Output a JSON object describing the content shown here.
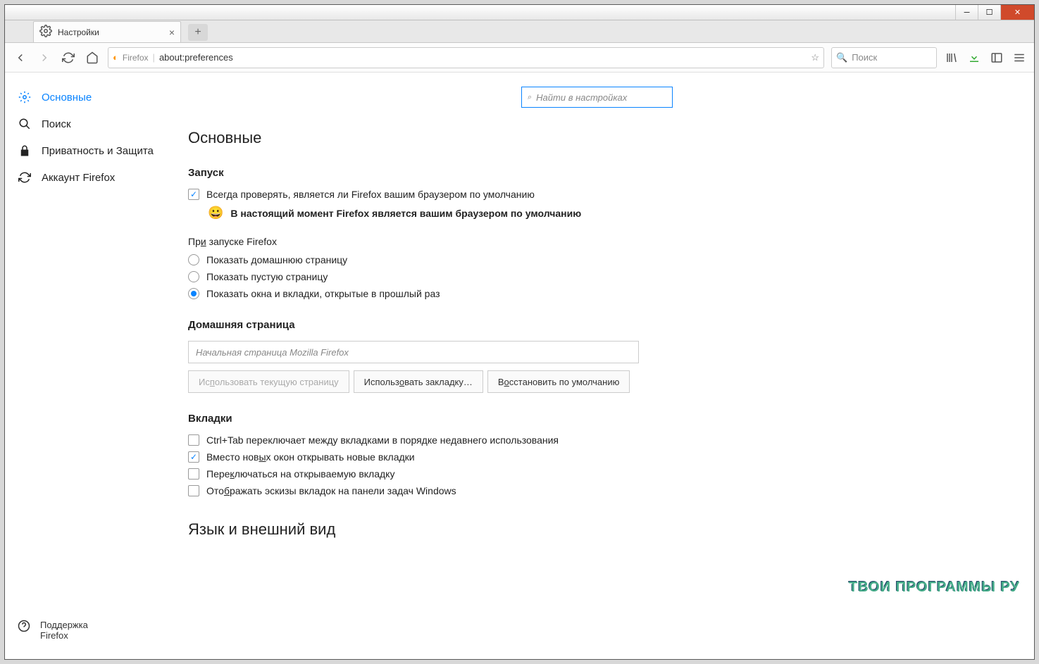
{
  "tab": {
    "title": "Настройки"
  },
  "urlbar": {
    "identity": "Firefox",
    "url": "about:preferences"
  },
  "searchbar": {
    "placeholder": "Поиск"
  },
  "sidebar": {
    "items": [
      {
        "label": "Основные"
      },
      {
        "label": "Поиск"
      },
      {
        "label": "Приватность и Защита"
      },
      {
        "label": "Аккаунт Firefox"
      }
    ],
    "help": "Поддержка Firefox"
  },
  "prefs_search": {
    "placeholder": "Найти в настройках"
  },
  "page": {
    "title": "Основные",
    "startup": {
      "heading": "Запуск",
      "check_default_pre": "Всег",
      "check_default_u": "д",
      "check_default_post": "а проверять, является ли Firefox вашим браузером по умолчанию",
      "status": "В настоящий момент Firefox является вашим браузером по умолчанию",
      "on_start_pre": "Пр",
      "on_start_u": "и",
      "on_start_post": " запуске Firefox",
      "opt_home": "Показать домашнюю страницу",
      "opt_blank": "Показать пустую страницу",
      "opt_restore": "Показать окна и вкладки, открытые в прошлый раз"
    },
    "home": {
      "heading": "Домашняя страница",
      "placeholder": "Начальная страница Mozilla Firefox",
      "btn_current_pre": "Ис",
      "btn_current_u": "п",
      "btn_current_post": "ользовать текущую страницу",
      "btn_bookmark_pre": "Использ",
      "btn_bookmark_u": "о",
      "btn_bookmark_post": "вать закладку…",
      "btn_restore_pre": "В",
      "btn_restore_u": "о",
      "btn_restore_post": "сстановить по умолчанию"
    },
    "tabs": {
      "heading": "Вкладки",
      "ctrl_tab": "Ctrl+Tab переключает между вкладками в порядке недавнего использования",
      "new_tab_pre": "Вместо нов",
      "new_tab_u": "ы",
      "new_tab_post": "х окон открывать новые вкладки",
      "switch_pre": "Пере",
      "switch_u": "к",
      "switch_post": "лючаться на открываемую вкладку",
      "thumb_pre": "Ото",
      "thumb_u": "б",
      "thumb_post": "ражать эскизы вкладок на панели задач Windows"
    },
    "lang_heading": "Язык и внешний вид"
  },
  "watermark": "ТВОИ ПРОГРАММЫ РУ"
}
